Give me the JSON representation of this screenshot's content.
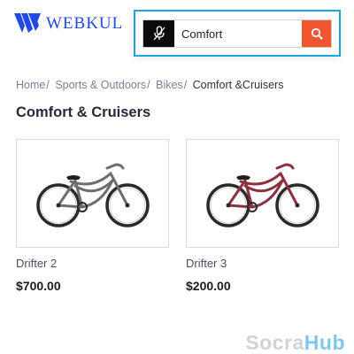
{
  "header": {
    "logo_text": "WEBKUL",
    "brand_color": "#2149e6",
    "logo_icon": "webkul-logo-icon"
  },
  "search": {
    "value": "Comfort",
    "mic_icon": "mic-off-icon",
    "search_icon": "search-icon",
    "accent_color": "#ef5630",
    "focus_border_color": "#1ba5db"
  },
  "breadcrumb": {
    "items": [
      "Home",
      "Sports & Outdoors",
      "Bikes"
    ],
    "current": "Comfort &Cruisers"
  },
  "page_title": "Comfort & Cruisers",
  "products": [
    {
      "name": "Drifter 2",
      "price": "$700.00",
      "image_icon": "gray-cruiser-bike-image",
      "frame_color": "#6b6e71"
    },
    {
      "name": "Drifter 3",
      "price": "$200.00",
      "image_icon": "red-cruiser-bike-image",
      "frame_color": "#8e2f3e"
    }
  ],
  "watermark": {
    "part1": "Socra",
    "part2": "Hub"
  }
}
